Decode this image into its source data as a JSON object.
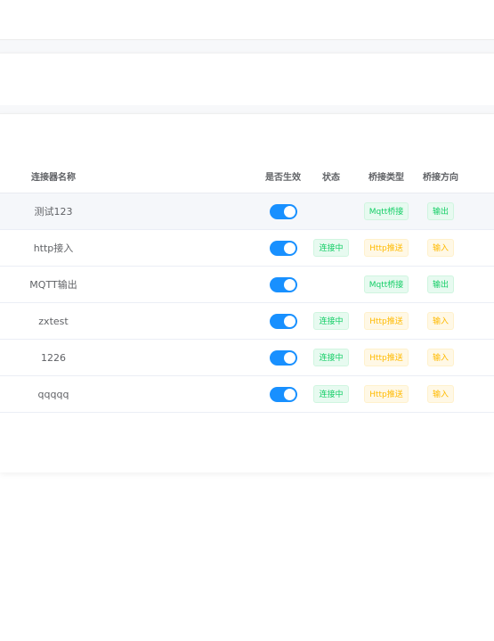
{
  "table": {
    "headers": {
      "name": "连接器名称",
      "enabled": "是否生效",
      "status": "状态",
      "bridge_type": "桥接类型",
      "direction": "桥接方向"
    },
    "rows": [
      {
        "name": "测试123",
        "enabled": true,
        "status": "",
        "bridge_type": "Mqtt桥接",
        "direction": "输出",
        "hover": true
      },
      {
        "name": "http接入",
        "enabled": true,
        "status": "连接中",
        "bridge_type": "Http推送",
        "direction": "输入"
      },
      {
        "name": "MQTT输出",
        "enabled": true,
        "status": "",
        "bridge_type": "Mqtt桥接",
        "direction": "输出"
      },
      {
        "name": "zxtest",
        "enabled": true,
        "status": "连接中",
        "bridge_type": "Http推送",
        "direction": "输入"
      },
      {
        "name": "1226",
        "enabled": true,
        "status": "连接中",
        "bridge_type": "Http推送",
        "direction": "输入"
      },
      {
        "name": "qqqqq",
        "enabled": true,
        "status": "连接中",
        "bridge_type": "Http推送",
        "direction": "输入"
      }
    ]
  },
  "colors": {
    "switch_on": "#1890ff",
    "tag_green": "#13ce66",
    "tag_orange": "#ffba00",
    "hover_row": "#f5f7fa"
  }
}
